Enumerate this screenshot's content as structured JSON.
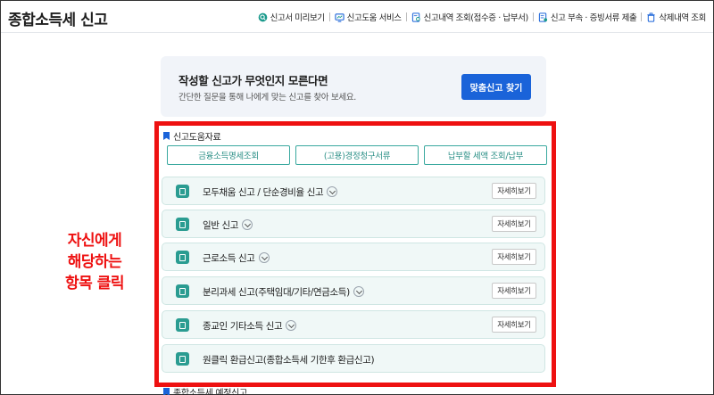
{
  "header": {
    "title": "종합소득세 신고",
    "links": [
      {
        "label": "신고서 미리보기",
        "icon": "magnifier-icon"
      },
      {
        "label": "신고도움 서비스",
        "icon": "monitor-icon"
      },
      {
        "label": "신고내역 조회(접수증 · 납부서)",
        "icon": "document-search-icon"
      },
      {
        "label": "신고 부속 · 증빙서류 제출",
        "icon": "document-upload-icon"
      },
      {
        "label": "삭제내역 조회",
        "icon": "trash-icon"
      }
    ]
  },
  "banner": {
    "title": "작성할 신고가 무엇인지 모른다면",
    "subtitle": "간단한 질문을 통해 나에게 맞는 신고를 찾아 보세요.",
    "button": "맞춤신고 찾기"
  },
  "help_section": {
    "label": "신고도움자료",
    "buttons": [
      "금융소득명세조회",
      "(고용)경정청구서류",
      "납부할 세액 조회/납부"
    ]
  },
  "items": [
    {
      "label": "모두채움 신고 / 단순경비율 신고",
      "detail": "자세히보기"
    },
    {
      "label": "일반 신고",
      "detail": "자세히보기"
    },
    {
      "label": "근로소득 신고",
      "detail": "자세히보기"
    },
    {
      "label": "분리과세 신고(주택임대/기타/연금소득)",
      "detail": "자세히보기"
    },
    {
      "label": "종교인 기타소득 신고",
      "detail": "자세히보기"
    },
    {
      "label": "원클릭 환급신고(종합소득세 기한후 환급신고)",
      "detail": ""
    }
  ],
  "annotation": {
    "lines": [
      "자신에게",
      "해당하는",
      "항목 클릭"
    ],
    "color": "#ee1111"
  },
  "bottom_section": {
    "label": "종합소득세 예정신고"
  },
  "colors": {
    "accent": "#1a63d9",
    "teal": "#2a9c91",
    "highlight": "#ee1111"
  }
}
